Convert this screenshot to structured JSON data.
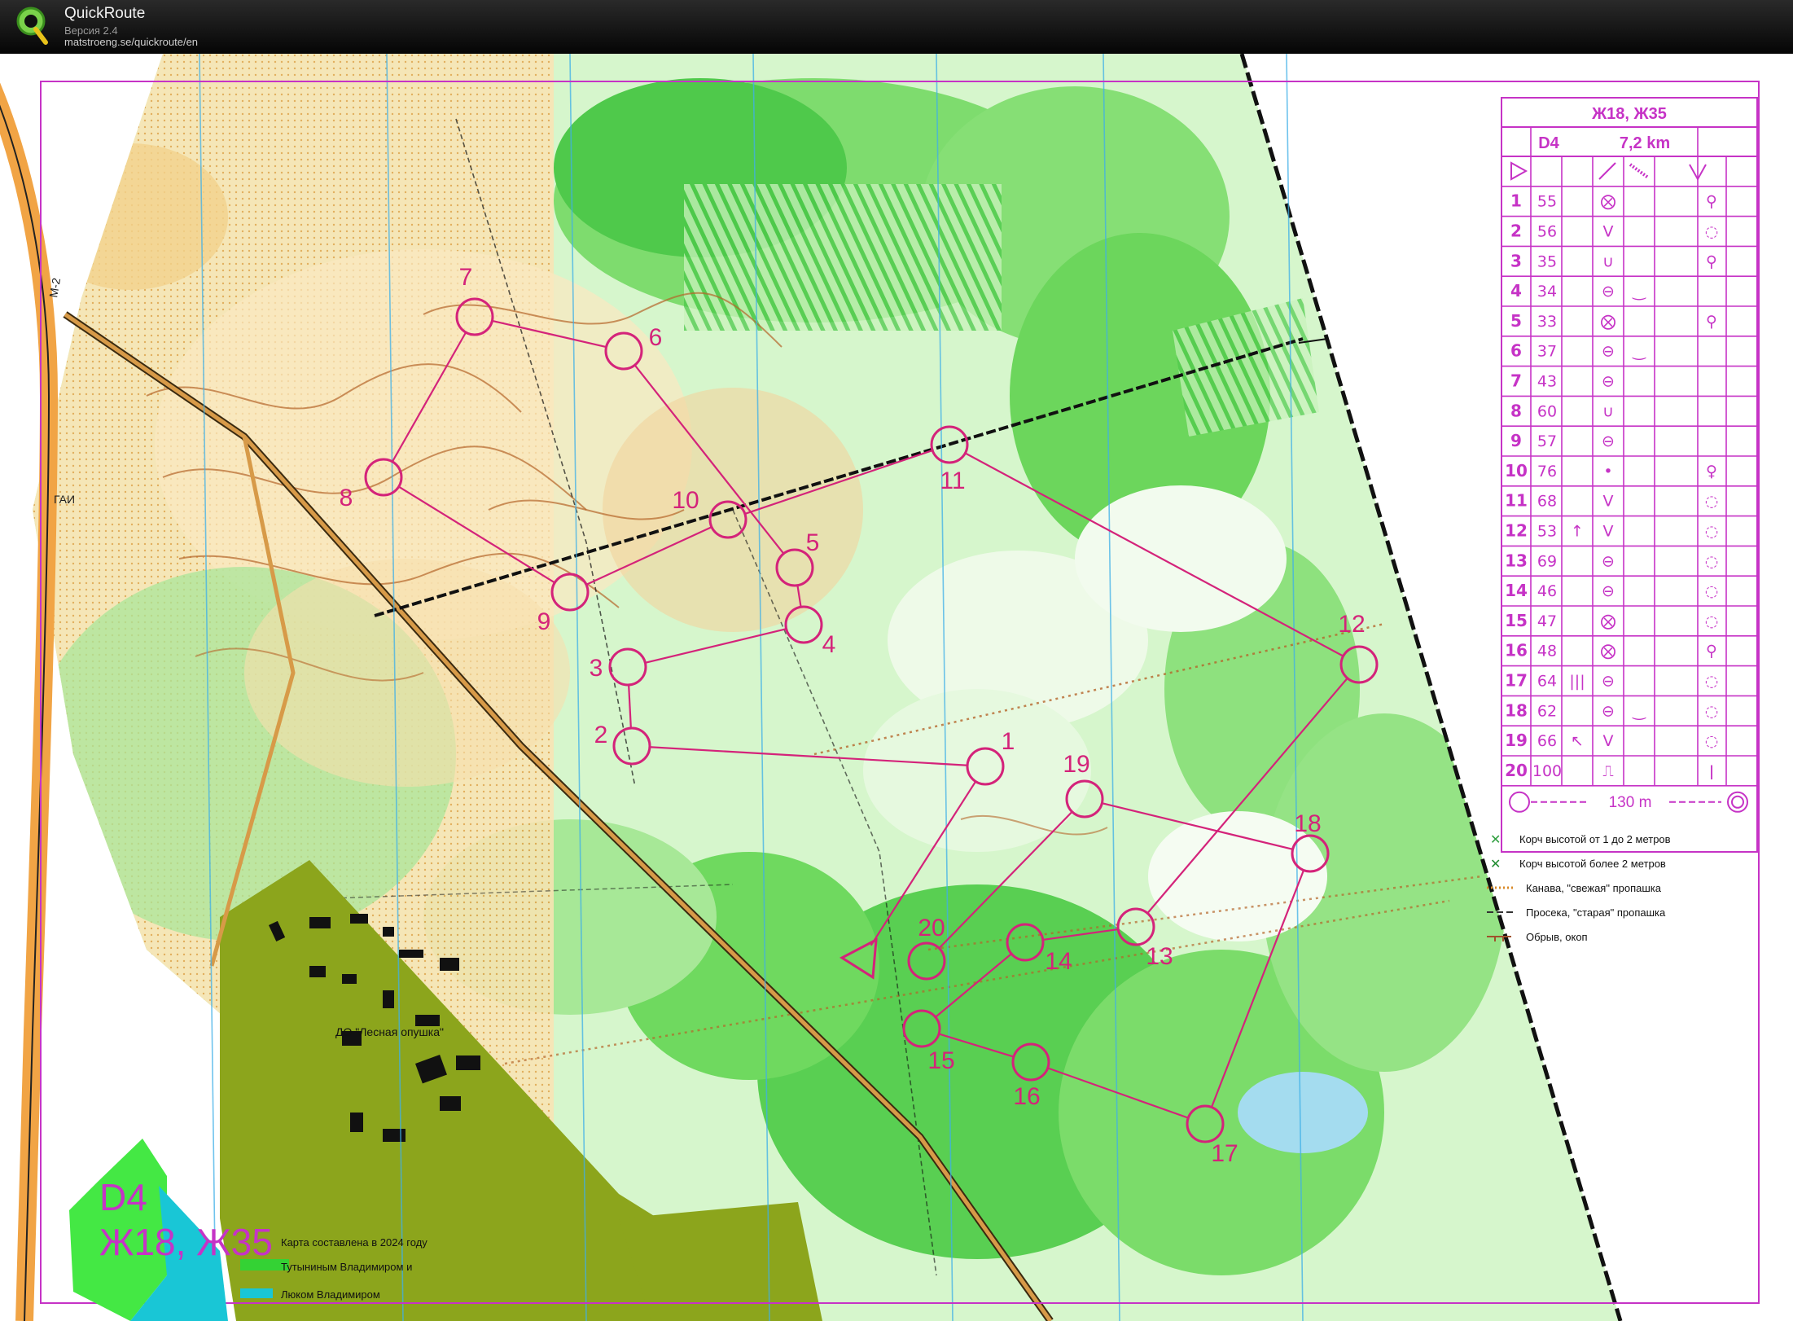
{
  "app": {
    "name": "QuickRoute",
    "version": "Версия 2.4",
    "url": "matstroeng.se/quickroute/en",
    "logo_icon": "quickroute-q-logo-icon"
  },
  "colors": {
    "course": "#d4237a",
    "legend_purple": "#c633c6",
    "forest_light": "#c3f0b4",
    "forest_mid": "#7ee06b",
    "forest_dark": "#3cc23a",
    "open_land": "#f8d28a",
    "contour": "#b5652a",
    "magnetic_north": "#3fb0e8",
    "settlement": "#8ca51c"
  },
  "map": {
    "road_label": "М-2",
    "gai_label": "ГАИ",
    "place_label": "ДО \"Лесная опушка\"",
    "credits": {
      "line1": "Карта составлена в 2024 году",
      "line2": "Тутыниным Владимиром и",
      "line3": "Люком Владимиром"
    }
  },
  "course_badge": {
    "line1": "D4",
    "line2": "Ж18, Ж35"
  },
  "control_description": {
    "title": "Ж18, Ж35",
    "course_code": "D4",
    "length": "7,2 km",
    "start_symbol": "triangle-start-icon",
    "rows": [
      {
        "n": "1",
        "code": "55",
        "c": "",
        "d": "⨂",
        "e": "",
        "g": "⚲"
      },
      {
        "n": "2",
        "code": "56",
        "c": "",
        "d": "V",
        "e": "",
        "g": "◌"
      },
      {
        "n": "3",
        "code": "35",
        "c": "",
        "d": "∪",
        "e": "",
        "g": "⚲"
      },
      {
        "n": "4",
        "code": "34",
        "c": "",
        "d": "⊖",
        "e": "‿",
        "g": ""
      },
      {
        "n": "5",
        "code": "33",
        "c": "",
        "d": "⨂",
        "e": "",
        "g": "⚲"
      },
      {
        "n": "6",
        "code": "37",
        "c": "",
        "d": "⊖",
        "e": "‿",
        "g": ""
      },
      {
        "n": "7",
        "code": "43",
        "c": "",
        "d": "⊖",
        "e": "",
        "g": ""
      },
      {
        "n": "8",
        "code": "60",
        "c": "",
        "d": "∪",
        "e": "",
        "g": ""
      },
      {
        "n": "9",
        "code": "57",
        "c": "",
        "d": "⊖",
        "e": "",
        "g": ""
      },
      {
        "n": "10",
        "code": "76",
        "c": "",
        "d": "•",
        "e": "",
        "g": "♀"
      },
      {
        "n": "11",
        "code": "68",
        "c": "",
        "d": "V",
        "e": "",
        "g": "◌"
      },
      {
        "n": "12",
        "code": "53",
        "c": "↑",
        "d": "V",
        "e": "",
        "g": "◌"
      },
      {
        "n": "13",
        "code": "69",
        "c": "",
        "d": "⊖",
        "e": "",
        "g": "◌"
      },
      {
        "n": "14",
        "code": "46",
        "c": "",
        "d": "⊖",
        "e": "",
        "g": "◌"
      },
      {
        "n": "15",
        "code": "47",
        "c": "",
        "d": "⨂",
        "e": "",
        "g": "◌"
      },
      {
        "n": "16",
        "code": "48",
        "c": "",
        "d": "⨂",
        "e": "",
        "g": "⚲"
      },
      {
        "n": "17",
        "code": "64",
        "c": "|||",
        "d": "⊖",
        "e": "",
        "g": "◌"
      },
      {
        "n": "18",
        "code": "62",
        "c": "",
        "d": "⊖",
        "e": "‿",
        "g": "◌"
      },
      {
        "n": "19",
        "code": "66",
        "c": "↖",
        "d": "V",
        "e": "",
        "g": "◌"
      },
      {
        "n": "20",
        "code": "100",
        "c": "",
        "d": "⎍",
        "e": "",
        "g": "ǀ"
      }
    ],
    "finish_distance": "130 m"
  },
  "legend": [
    {
      "symbol": "x",
      "color": "#2e9e3e",
      "label": "Корч высотой от 1 до 2 метров"
    },
    {
      "symbol": "x",
      "color": "#1f8b2f",
      "label": "Корч высотой более 2 метров"
    },
    {
      "symbol": "dots",
      "color": "#d98a28",
      "label": "Канава, \"свежая\" пропашка"
    },
    {
      "symbol": "dash",
      "color": "#333333",
      "label": "Просека, \"старая\" пропашка"
    },
    {
      "symbol": "cliff",
      "color": "#a0522d",
      "label": "Обрыв, окоп"
    }
  ],
  "course": {
    "start": {
      "label": ""
    },
    "controls": [
      {
        "n": "1"
      },
      {
        "n": "2"
      },
      {
        "n": "3"
      },
      {
        "n": "4"
      },
      {
        "n": "5"
      },
      {
        "n": "6"
      },
      {
        "n": "7"
      },
      {
        "n": "8"
      },
      {
        "n": "9"
      },
      {
        "n": "10"
      },
      {
        "n": "11"
      },
      {
        "n": "12"
      },
      {
        "n": "13"
      },
      {
        "n": "14"
      },
      {
        "n": "15"
      },
      {
        "n": "16"
      },
      {
        "n": "17"
      },
      {
        "n": "18"
      },
      {
        "n": "19"
      },
      {
        "n": "20"
      }
    ]
  }
}
